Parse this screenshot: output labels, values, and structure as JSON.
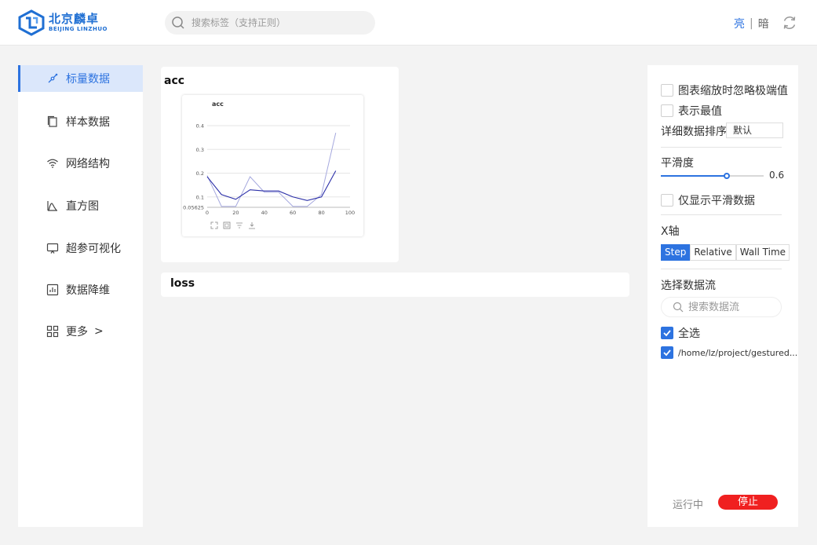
{
  "header": {
    "logo_cn": "北京麟卓",
    "logo_en": "BEIJING LINZHUO",
    "search_placeholder": "搜索标签（支持正则）",
    "theme_light": "亮",
    "theme_sep": "|",
    "theme_dark": "暗"
  },
  "sidebar": {
    "items": [
      {
        "label": "标量数据",
        "icon": "scalar-icon",
        "active": true
      },
      {
        "label": "样本数据",
        "icon": "sample-icon"
      },
      {
        "label": "网络结构",
        "icon": "wifi-icon"
      },
      {
        "label": "直方图",
        "icon": "histogram-icon"
      },
      {
        "label": "超参可视化",
        "icon": "monitor-icon"
      },
      {
        "label": "数据降维",
        "icon": "chart-icon"
      },
      {
        "label": "更多",
        "icon": "grid-icon",
        "suffix": ">"
      }
    ]
  },
  "main": {
    "cards": [
      {
        "title": "acc"
      },
      {
        "title": "loss"
      }
    ]
  },
  "chart_data": {
    "type": "line",
    "title": "acc",
    "xlabel": "",
    "ylabel": "",
    "xlim": [
      0,
      100
    ],
    "ylim": [
      0.05625,
      0.42
    ],
    "x_ticks": [
      "0",
      "20",
      "40",
      "60",
      "80",
      "100"
    ],
    "y_ticks": [
      "0.05625",
      "0.1",
      "0.2",
      "0.3",
      "0.4"
    ],
    "series": [
      {
        "role": "raw",
        "color": "#a5a8de",
        "x": [
          0,
          10,
          20,
          30,
          40,
          50,
          60,
          70,
          80,
          90
        ],
        "y": [
          0.19,
          0.06,
          0.06,
          0.185,
          0.12,
          0.12,
          0.06,
          0.06,
          0.11,
          0.37
        ]
      },
      {
        "role": "smoothed",
        "color": "#2b2fa8",
        "x": [
          0,
          10,
          20,
          30,
          40,
          50,
          60,
          70,
          80,
          90
        ],
        "y": [
          0.185,
          0.11,
          0.09,
          0.13,
          0.125,
          0.125,
          0.1,
          0.085,
          0.1,
          0.21
        ]
      }
    ],
    "toolbar_icons": [
      "fullscreen-icon",
      "select-icon",
      "filter-icon",
      "download-icon"
    ]
  },
  "panel": {
    "ignore_outliers": "图表缩放时忽略极端值",
    "show_extreme": "表示最值",
    "sort_label": "详细数据排序",
    "sort_value": "默认",
    "smoothing_label": "平滑度",
    "smoothing_value": "0.6",
    "smoothing_level": 0.6,
    "only_smoothed": "仅显示平滑数据",
    "xaxis_label": "X轴",
    "xaxis_options": [
      "Step",
      "Relative",
      "Wall Time"
    ],
    "xaxis_selected": "Step",
    "stream_label": "选择数据流",
    "stream_search_placeholder": "搜索数据流",
    "select_all": "全选",
    "stream_path": "/home/lz/project/gestured...",
    "status": "运行中",
    "stop": "停止",
    "accent": "#2d73e0"
  }
}
